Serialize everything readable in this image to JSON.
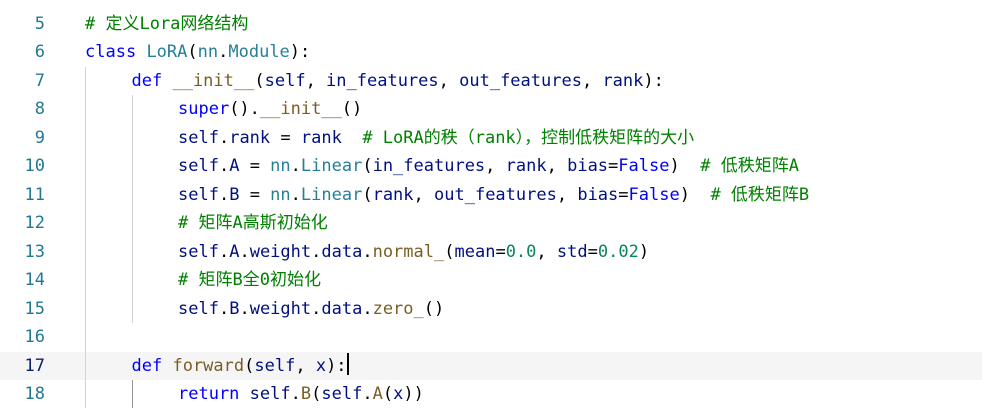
{
  "editor": {
    "colors": {
      "keyword": "#0000ff",
      "call": "#795e26",
      "param": "#001080",
      "comment": "#008000",
      "number": "#098658",
      "class": "#267f99",
      "line_number": "#237893",
      "line_number_active": "#0b216f",
      "current_line_bg": "#f5f5f5"
    },
    "active_line_number": "17",
    "lines": [
      {
        "number": "5",
        "indent": 0,
        "tokens": [
          {
            "t": "comment",
            "v": "# 定义Lora网络结构"
          }
        ]
      },
      {
        "number": "6",
        "indent": 0,
        "tokens": [
          {
            "t": "keyword",
            "v": "class"
          },
          {
            "t": "plain",
            "v": " "
          },
          {
            "t": "class",
            "v": "LoRA"
          },
          {
            "t": "op",
            "v": "("
          },
          {
            "t": "class",
            "v": "nn"
          },
          {
            "t": "op",
            "v": "."
          },
          {
            "t": "class",
            "v": "Module"
          },
          {
            "t": "op",
            "v": "):"
          }
        ]
      },
      {
        "number": "7",
        "indent": 1,
        "tokens": [
          {
            "t": "keyword",
            "v": "def"
          },
          {
            "t": "plain",
            "v": " "
          },
          {
            "t": "call",
            "v": "__init__"
          },
          {
            "t": "op",
            "v": "("
          },
          {
            "t": "param",
            "v": "self"
          },
          {
            "t": "op",
            "v": ", "
          },
          {
            "t": "param",
            "v": "in_features"
          },
          {
            "t": "op",
            "v": ", "
          },
          {
            "t": "param",
            "v": "out_features"
          },
          {
            "t": "op",
            "v": ", "
          },
          {
            "t": "param",
            "v": "rank"
          },
          {
            "t": "op",
            "v": "):"
          }
        ]
      },
      {
        "number": "8",
        "indent": 2,
        "tokens": [
          {
            "t": "keyword",
            "v": "super"
          },
          {
            "t": "op",
            "v": "()."
          },
          {
            "t": "call",
            "v": "__init__"
          },
          {
            "t": "op",
            "v": "()"
          }
        ]
      },
      {
        "number": "9",
        "indent": 2,
        "tokens": [
          {
            "t": "param",
            "v": "self"
          },
          {
            "t": "op",
            "v": "."
          },
          {
            "t": "param",
            "v": "rank"
          },
          {
            "t": "op",
            "v": " = "
          },
          {
            "t": "param",
            "v": "rank"
          },
          {
            "t": "plain",
            "v": "  "
          },
          {
            "t": "comment",
            "v": "# LoRA的秩（rank），控制低秩矩阵的大小"
          }
        ]
      },
      {
        "number": "10",
        "indent": 2,
        "tokens": [
          {
            "t": "param",
            "v": "self"
          },
          {
            "t": "op",
            "v": "."
          },
          {
            "t": "param",
            "v": "A"
          },
          {
            "t": "op",
            "v": " = "
          },
          {
            "t": "class",
            "v": "nn"
          },
          {
            "t": "op",
            "v": "."
          },
          {
            "t": "class",
            "v": "Linear"
          },
          {
            "t": "op",
            "v": "("
          },
          {
            "t": "param",
            "v": "in_features"
          },
          {
            "t": "op",
            "v": ", "
          },
          {
            "t": "param",
            "v": "rank"
          },
          {
            "t": "op",
            "v": ", "
          },
          {
            "t": "param",
            "v": "bias"
          },
          {
            "t": "op",
            "v": "="
          },
          {
            "t": "keyword",
            "v": "False"
          },
          {
            "t": "op",
            "v": ")"
          },
          {
            "t": "plain",
            "v": "  "
          },
          {
            "t": "comment",
            "v": "# 低秩矩阵A"
          }
        ]
      },
      {
        "number": "11",
        "indent": 2,
        "tokens": [
          {
            "t": "param",
            "v": "self"
          },
          {
            "t": "op",
            "v": "."
          },
          {
            "t": "param",
            "v": "B"
          },
          {
            "t": "op",
            "v": " = "
          },
          {
            "t": "class",
            "v": "nn"
          },
          {
            "t": "op",
            "v": "."
          },
          {
            "t": "class",
            "v": "Linear"
          },
          {
            "t": "op",
            "v": "("
          },
          {
            "t": "param",
            "v": "rank"
          },
          {
            "t": "op",
            "v": ", "
          },
          {
            "t": "param",
            "v": "out_features"
          },
          {
            "t": "op",
            "v": ", "
          },
          {
            "t": "param",
            "v": "bias"
          },
          {
            "t": "op",
            "v": "="
          },
          {
            "t": "keyword",
            "v": "False"
          },
          {
            "t": "op",
            "v": ")"
          },
          {
            "t": "plain",
            "v": "  "
          },
          {
            "t": "comment",
            "v": "# 低秩矩阵B"
          }
        ]
      },
      {
        "number": "12",
        "indent": 2,
        "tokens": [
          {
            "t": "comment",
            "v": "# 矩阵A高斯初始化"
          }
        ]
      },
      {
        "number": "13",
        "indent": 2,
        "tokens": [
          {
            "t": "param",
            "v": "self"
          },
          {
            "t": "op",
            "v": "."
          },
          {
            "t": "param",
            "v": "A"
          },
          {
            "t": "op",
            "v": "."
          },
          {
            "t": "param",
            "v": "weight"
          },
          {
            "t": "op",
            "v": "."
          },
          {
            "t": "param",
            "v": "data"
          },
          {
            "t": "op",
            "v": "."
          },
          {
            "t": "call",
            "v": "normal_"
          },
          {
            "t": "op",
            "v": "("
          },
          {
            "t": "param",
            "v": "mean"
          },
          {
            "t": "op",
            "v": "="
          },
          {
            "t": "number",
            "v": "0.0"
          },
          {
            "t": "op",
            "v": ", "
          },
          {
            "t": "param",
            "v": "std"
          },
          {
            "t": "op",
            "v": "="
          },
          {
            "t": "number",
            "v": "0.02"
          },
          {
            "t": "op",
            "v": ")"
          }
        ]
      },
      {
        "number": "14",
        "indent": 2,
        "tokens": [
          {
            "t": "comment",
            "v": "# 矩阵B全0初始化"
          }
        ]
      },
      {
        "number": "15",
        "indent": 2,
        "tokens": [
          {
            "t": "param",
            "v": "self"
          },
          {
            "t": "op",
            "v": "."
          },
          {
            "t": "param",
            "v": "B"
          },
          {
            "t": "op",
            "v": "."
          },
          {
            "t": "param",
            "v": "weight"
          },
          {
            "t": "op",
            "v": "."
          },
          {
            "t": "param",
            "v": "data"
          },
          {
            "t": "op",
            "v": "."
          },
          {
            "t": "call",
            "v": "zero_"
          },
          {
            "t": "op",
            "v": "()"
          }
        ]
      },
      {
        "number": "16",
        "indent": 0,
        "tokens": []
      },
      {
        "number": "17",
        "indent": 1,
        "current": true,
        "tokens": [
          {
            "t": "keyword",
            "v": "def"
          },
          {
            "t": "plain",
            "v": " "
          },
          {
            "t": "call",
            "v": "forward"
          },
          {
            "t": "op",
            "v": "("
          },
          {
            "t": "param",
            "v": "self"
          },
          {
            "t": "op",
            "v": ", "
          },
          {
            "t": "param",
            "v": "x"
          },
          {
            "t": "op",
            "v": "):"
          },
          {
            "t": "cursor",
            "v": ""
          }
        ]
      },
      {
        "number": "18",
        "indent": 2,
        "tokens": [
          {
            "t": "keyword",
            "v": "return"
          },
          {
            "t": "plain",
            "v": " "
          },
          {
            "t": "param",
            "v": "self"
          },
          {
            "t": "op",
            "v": "."
          },
          {
            "t": "call",
            "v": "B"
          },
          {
            "t": "op",
            "v": "("
          },
          {
            "t": "param",
            "v": "self"
          },
          {
            "t": "op",
            "v": "."
          },
          {
            "t": "call",
            "v": "A"
          },
          {
            "t": "op",
            "v": "("
          },
          {
            "t": "param",
            "v": "x"
          },
          {
            "t": "op",
            "v": "))"
          }
        ]
      }
    ]
  }
}
